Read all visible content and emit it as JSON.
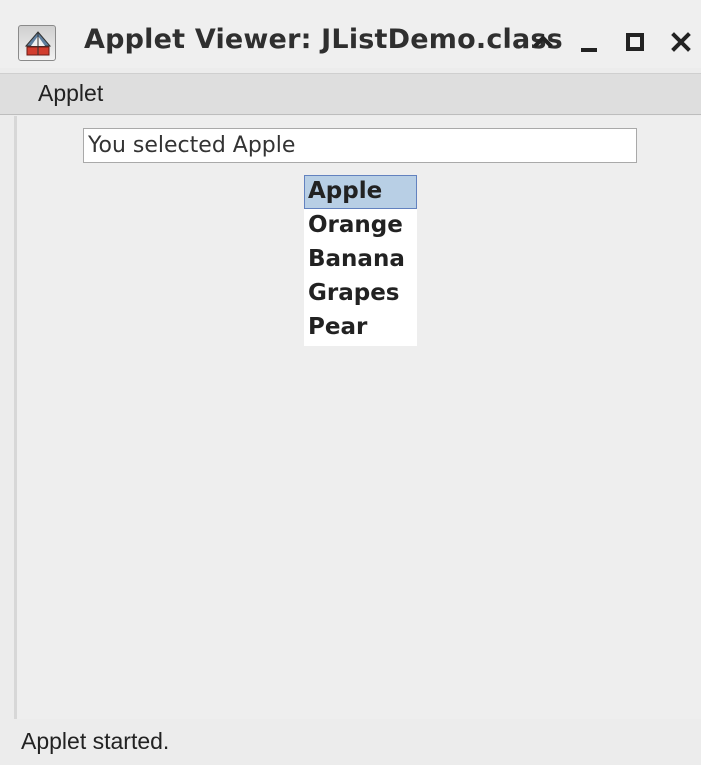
{
  "window": {
    "title": "Applet Viewer: JListDemo.class",
    "app_icon": "java-applet-icon",
    "controls": [
      "maximize-restore-icon",
      "minimize-icon",
      "maximize-icon",
      "close-icon"
    ]
  },
  "menubar": {
    "items": [
      {
        "label": "Applet"
      }
    ]
  },
  "main": {
    "selection_text": "You selected Apple",
    "list": {
      "items": [
        "Apple",
        "Orange",
        "Banana",
        "Grapes",
        "Pear"
      ],
      "selected": "Apple"
    }
  },
  "statusbar": {
    "text": "Applet started."
  },
  "colors": {
    "background": "#ececec",
    "selection": "#b8cfe5",
    "selection_border": "#6382bf"
  }
}
